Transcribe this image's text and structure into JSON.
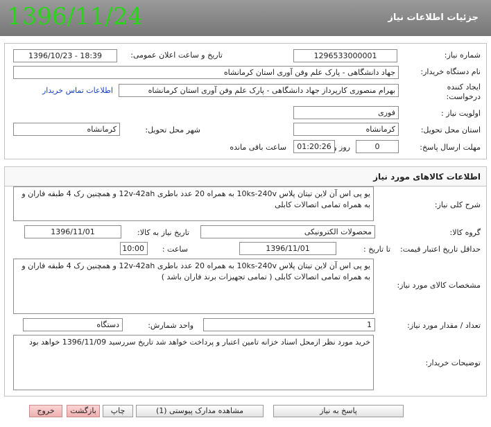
{
  "header": {
    "date_stamp": "1396/11/24",
    "title": "جزئیات اطلاعات نیاز"
  },
  "info": {
    "need_number_label": "شماره نیاز:",
    "need_number": "1296533000001",
    "announce_label": "تاریخ و ساعت اعلان عمومی:",
    "announce_value": "1396/10/23 - 18:39",
    "buyer_label": "نام دستگاه خریدار:",
    "buyer_value": "جهاد دانشگاهی - پارک علم وفن آوری استان کرمانشاه",
    "creator_label": "ایجاد کننده درخواست:",
    "creator_value": "بهرام منصوری کارپرداز جهاد دانشگاهی - پارک علم وفن آوری استان کرمانشاه",
    "contact_link": "اطلاعات تماس خریدار",
    "priority_label": "اولویت نیاز :",
    "priority_value": "فوری",
    "province_label": "استان محل تحویل:",
    "province_value": "کرمانشاه",
    "city_label": "شهر محل تحویل:",
    "city_value": "کرمانشاه",
    "deadline_label": "مهلت ارسال پاسخ:",
    "days_value": "0",
    "days_word": "روز و",
    "time_remaining": "01:20:26",
    "remaining_word": "ساعت باقی مانده"
  },
  "goods": {
    "section_title": "اطلاعات کالاهای مورد نیاز",
    "general_desc_label": "شرح کلی نیاز:",
    "general_desc": "یو پی اس آن لاین تیتان پلاس 10ks-240v به همراه 20 عدد باطری 12v-42ah و همچنین رک 4 طبقه فاران و به همراه تمامی اتصالات کابلی",
    "group_label": "گروه کالا:",
    "group_value": "محصولات الکترونیکی",
    "need_date_label": "تاریخ نیاز به کالا:",
    "need_date_value": "1396/11/01",
    "min_price_label": "حداقل تاریخ اعتبار قیمت:",
    "until_date_label": "تا تاریخ :",
    "until_date_value": "1396/11/01",
    "hour_label": "ساعت :",
    "hour_value": "10:00",
    "spec_label": "مشخصات کالای مورد نیاز:",
    "spec_value": "یو پی اس آن لاین تیتان پلاس 10ks-240v به همراه 20 عدد باطری 12v-42ah و همچنین رک 4 طبقه فاران و به همراه تمامی اتصالات کابلی ( تمامی تجهیزات برند فاران باشد )",
    "qty_label": "تعداد / مقدار مورد نیاز:",
    "qty_value": "1",
    "unit_label": "واحد شمارش:",
    "unit_value": "دستگاه",
    "buyer_notes_label": "توضیحات خریدار:",
    "buyer_notes_value": "خرید مورد نظر ازمحل اسناد خزانه تامین اعتبار و پرداخت خواهد شد تاریخ سررسید 1396/11/09 خواهد بود"
  },
  "buttons": {
    "respond": "پاسخ به نیاز",
    "attachments": "مشاهده مدارک پیوستی (1)",
    "print": "چاپ",
    "back": "بازگشت",
    "exit": "خروج"
  },
  "colors": {
    "date_stamp": "#2bd41b",
    "titlebar": "#8a8a8a",
    "link": "#1a3fc4",
    "red_button": "#f4bcbc"
  }
}
